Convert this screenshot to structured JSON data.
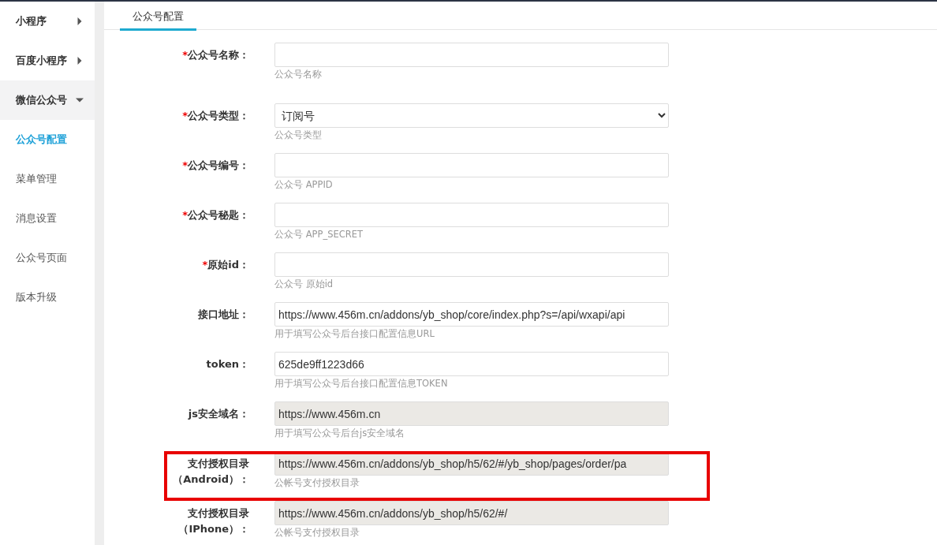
{
  "sidebar": {
    "items": [
      {
        "label": "小程序",
        "expanded": false
      },
      {
        "label": "百度小程序",
        "expanded": false
      },
      {
        "label": "微信公众号",
        "expanded": true,
        "children": [
          {
            "label": "公众号配置",
            "selected": true
          },
          {
            "label": "菜单管理",
            "selected": false
          },
          {
            "label": "消息设置",
            "selected": false
          },
          {
            "label": "公众号页面",
            "selected": false
          },
          {
            "label": "版本升级",
            "selected": false
          }
        ]
      }
    ]
  },
  "tabs": [
    {
      "label": "公众号配置",
      "selected": true
    }
  ],
  "form": {
    "fields": [
      {
        "kind": "text",
        "marker": "*",
        "label": "公众号名称：",
        "readonly": false,
        "help": "公众号名称",
        "highlighted": false
      },
      {
        "kind": "select",
        "marker": "*",
        "label": "公众号类型：",
        "readonly": false,
        "value": "订阅号",
        "help": "公众号类型",
        "highlighted": false
      },
      {
        "kind": "text",
        "marker": "*",
        "label": "公众号编号：",
        "readonly": false,
        "help": "公众号 APPID",
        "highlighted": false
      },
      {
        "kind": "text",
        "marker": "*",
        "label": "公众号秘匙：",
        "readonly": false,
        "help": "公众号 APP_SECRET",
        "highlighted": false
      },
      {
        "kind": "text",
        "marker": "*",
        "label": "原始id：",
        "readonly": false,
        "help": "公众号 原始id",
        "highlighted": false
      },
      {
        "kind": "text",
        "label": "接口地址：",
        "readonly": false,
        "value": "https://www.456m.cn/addons/yb_shop/core/index.php?s=/api/wxapi/api",
        "help": "用于填写公众号后台接口配置信息URL",
        "highlighted": false
      },
      {
        "kind": "text",
        "label": "token：",
        "readonly": false,
        "value": "625de9ff1223d66",
        "help": "用于填写公众号后台接口配置信息TOKEN",
        "highlighted": false
      },
      {
        "kind": "text",
        "label": "js安全域名：",
        "readonly": true,
        "value": "https://www.456m.cn",
        "help": "用于填写公众号后台js安全域名",
        "highlighted": false
      },
      {
        "kind": "text",
        "label": "支付授权目录",
        "label_line2": "（Android）：",
        "readonly": true,
        "value": "https://www.456m.cn/addons/yb_shop/h5/62/#/yb_shop/pages/order/pa",
        "help": "公帐号支付授权目录",
        "highlighted": true
      },
      {
        "kind": "text",
        "label": "支付授权目录",
        "label_line2": "（IPhone）：",
        "readonly": true,
        "value": "https://www.456m.cn/addons/yb_shop/h5/62/#/",
        "help": "公帐号支付授权目录",
        "highlighted": false
      }
    ]
  }
}
